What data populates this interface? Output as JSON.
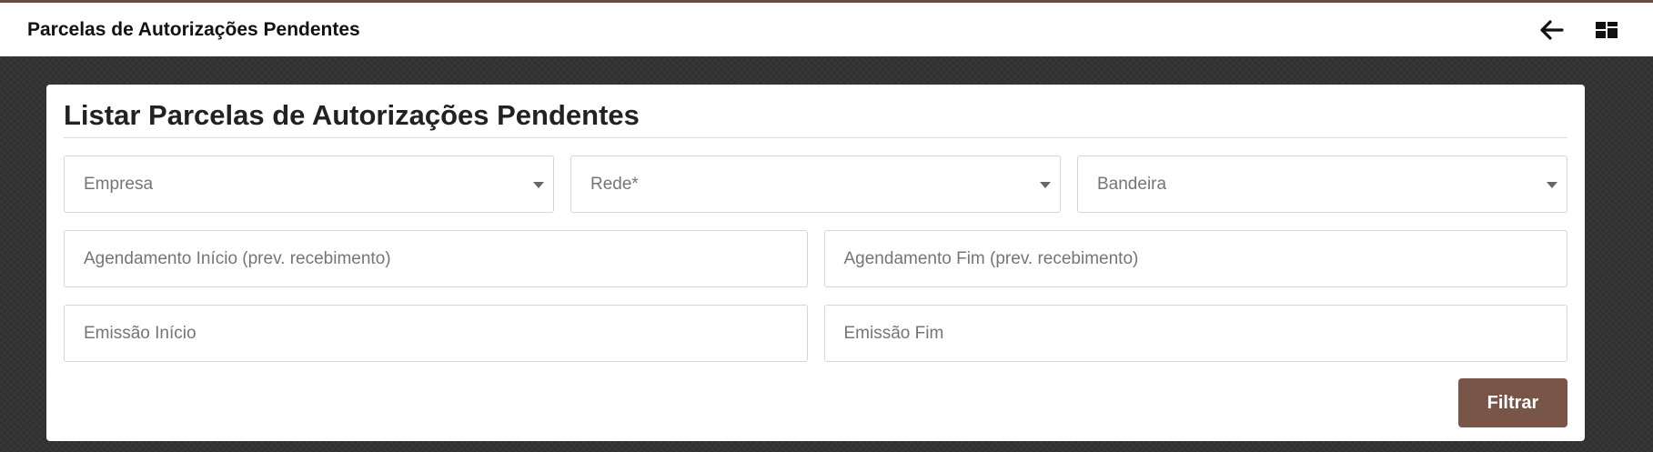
{
  "header": {
    "title": "Parcelas de Autorizações Pendentes",
    "back_icon": "arrow-left-icon",
    "dashboard_icon": "dashboard-grid-icon"
  },
  "form": {
    "title": "Listar Parcelas de Autorizações Pendentes",
    "empresa_placeholder": "Empresa",
    "rede_placeholder": "Rede*",
    "bandeira_placeholder": "Bandeira",
    "agendamento_inicio_placeholder": "Agendamento Início (prev. recebimento)",
    "agendamento_fim_placeholder": "Agendamento Fim (prev. recebimento)",
    "emissao_inicio_placeholder": "Emissão Início",
    "emissao_fim_placeholder": "Emissão Fim",
    "filter_button_label": "Filtrar"
  },
  "colors": {
    "accent": "#795548",
    "background": "#333333"
  }
}
